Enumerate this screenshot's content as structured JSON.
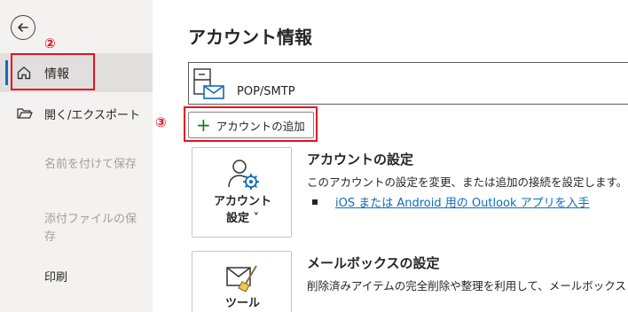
{
  "sidebar": {
    "items": [
      {
        "label": "情報",
        "icon": "home-icon"
      },
      {
        "label": "開く/エクスポート",
        "icon": "folder-open-icon"
      }
    ],
    "disabled": [
      "名前を付けて保存",
      "添付ファイルの保存"
    ],
    "print_label": "印刷"
  },
  "annotations": {
    "step2": "②",
    "step3": "③"
  },
  "main": {
    "title": "アカウント情報",
    "account_type": "POP/SMTP",
    "add_account_label": "アカウントの追加",
    "account_settings": {
      "tile_line1": "アカウント",
      "tile_line2": "設定 ˅",
      "heading": "アカウントの設定",
      "description": "このアカウントの設定を変更、または追加の接続を設定します。",
      "link": "iOS または Android 用の Outlook アプリを入手"
    },
    "mailbox_settings": {
      "tile_line1": "ツール",
      "heading": "メールボックスの設定",
      "description": "削除済みアイテムの完全削除や整理を利用して、メールボックス"
    }
  },
  "colors": {
    "accent": "#0f6cbd",
    "annotation_red": "#e81123",
    "sidebar_bg": "#f3f2f1"
  }
}
